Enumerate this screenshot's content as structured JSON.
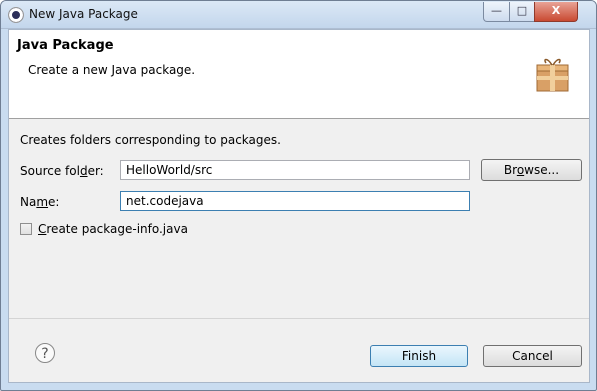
{
  "window": {
    "title": "New Java Package"
  },
  "controls": {
    "minimize_glyph": "—",
    "maximize_glyph": "□",
    "close_glyph": "X"
  },
  "banner": {
    "title": "Java Package",
    "description": "Create a new Java package.",
    "icon": "package-icon"
  },
  "main": {
    "description": "Creates folders corresponding to packages.",
    "source_folder": {
      "label_pre": "Source fol",
      "label_key": "d",
      "label_post": "er:",
      "value": "HelloWorld/src"
    },
    "browse_button": {
      "label_pre": "Br",
      "label_key": "o",
      "label_post": "wse..."
    },
    "name": {
      "label_pre": "Na",
      "label_key": "m",
      "label_post": "e:",
      "value": "net.codejava"
    },
    "package_info": {
      "label_key": "C",
      "label_post": "reate package-info.java",
      "checked": false
    }
  },
  "footer": {
    "help_glyph": "?",
    "finish_label": "Finish",
    "cancel_label": "Cancel"
  },
  "colors": {
    "accent": "#3c7fb1",
    "window_frame": "#c9dcf0",
    "close_button": "#c94a32"
  }
}
